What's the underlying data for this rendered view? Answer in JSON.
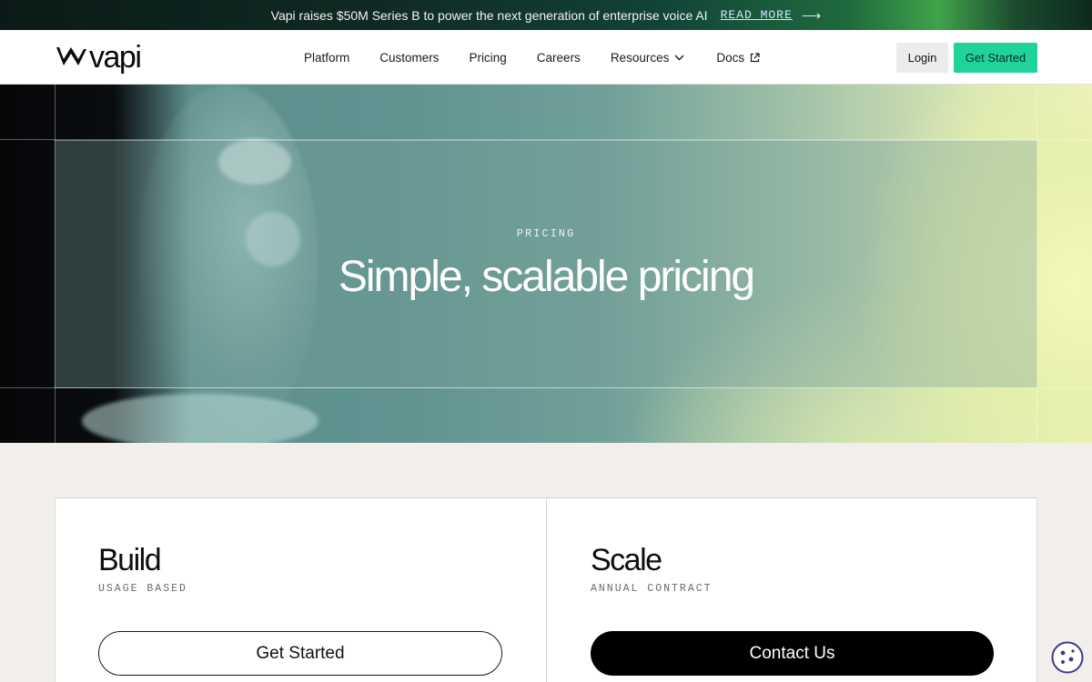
{
  "announcement": {
    "text": "Vapi raises $50M Series B to power the next generation of enterprise voice AI",
    "link_label": "READ MORE",
    "arrow": "⟶"
  },
  "nav": {
    "logo_text": "vapi",
    "items": [
      {
        "label": "Platform"
      },
      {
        "label": "Customers"
      },
      {
        "label": "Pricing"
      },
      {
        "label": "Careers"
      },
      {
        "label": "Resources",
        "icon": "chevron-down-icon"
      },
      {
        "label": "Docs",
        "icon": "external-link-icon"
      }
    ],
    "login_label": "Login",
    "get_started_label": "Get Started"
  },
  "hero": {
    "eyebrow": "PRICING",
    "title": "Simple, scalable pricing"
  },
  "plans": [
    {
      "name": "Build",
      "subtitle": "USAGE BASED",
      "cta": "Get Started"
    },
    {
      "name": "Scale",
      "subtitle": "ANNUAL CONTRACT",
      "cta": "Contact Us"
    }
  ],
  "colors": {
    "accent": "#1fd39a",
    "cta_dark": "#000000",
    "page_bg": "#f1eeeb"
  },
  "cookie_widget": {
    "icon": "cookie-icon"
  }
}
